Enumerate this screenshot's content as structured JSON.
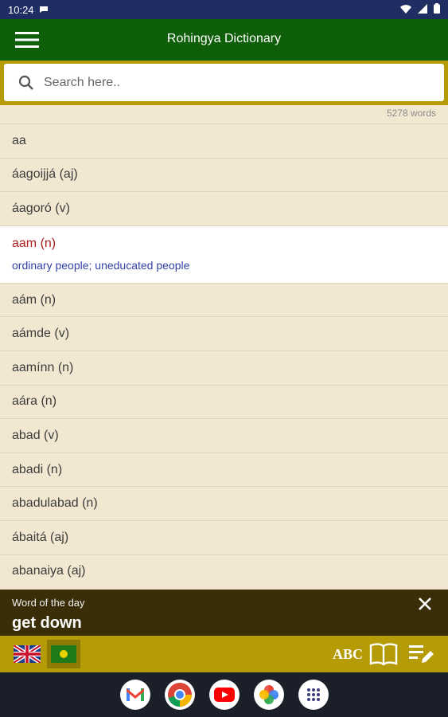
{
  "status_bar": {
    "time": "10:24"
  },
  "app_bar": {
    "title": "Rohingya Dictionary"
  },
  "search": {
    "placeholder": "Search here.."
  },
  "word_count": "5278 words",
  "words": {
    "items": [
      "aa",
      "áagoijjá (aj)",
      "áagoró (v)",
      "aam (n)",
      "aám (n)",
      "aámde (v)",
      "aamínn (n)",
      "aára (n)",
      "abad (v)",
      "abadi (n)",
      "abadulabad (n)",
      "ábaitá (aj)",
      "abanaiya (aj)"
    ],
    "selected_definition": "ordinary people; uneducated people"
  },
  "word_of_the_day": {
    "label": "Word of the day",
    "word": "get down"
  },
  "bottom_bar": {
    "abc_label": "ABC"
  },
  "colors": {
    "app_bar": "#0e5e0a",
    "search_band": "#b59b05",
    "list_bg": "#f2e7d0",
    "selected_word": "#b01e1e",
    "definition": "#3340a8",
    "wotd_bg": "#3a2e08"
  }
}
